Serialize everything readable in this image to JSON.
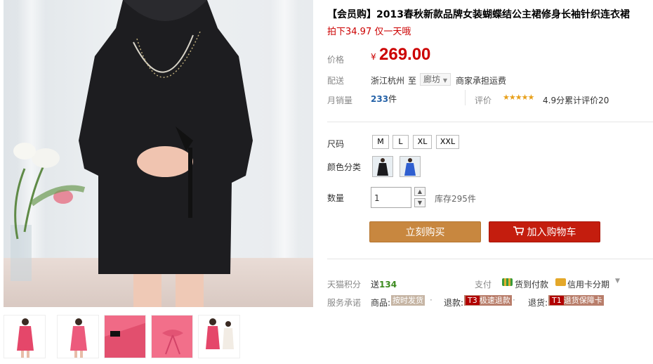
{
  "product": {
    "title": "【会员购】2013春秋新款品牌女装蝴蝶结公主裙修身长袖针织连衣裙",
    "promo": "拍下34.97 仅一天哦"
  },
  "price": {
    "label": "价格",
    "currency": "¥",
    "value": "269.00"
  },
  "shipping": {
    "label": "配送",
    "origin": "浙江杭州",
    "to": "至",
    "destination": "廊坊",
    "note": "商家承担运费"
  },
  "sales": {
    "label": "月销量",
    "count": "233",
    "unit": "件"
  },
  "rating": {
    "label": "评价",
    "stars": "★★★★★",
    "text": "4.9分累计评价20"
  },
  "size": {
    "label": "尺码",
    "options": [
      "M",
      "L",
      "XL",
      "XXL"
    ]
  },
  "color": {
    "label": "颜色分类",
    "options": [
      "black-dress",
      "blue-dress"
    ]
  },
  "quantity": {
    "label": "数量",
    "value": "1",
    "stock": "库存295件"
  },
  "buttons": {
    "buy": "立刻购买",
    "cart": "加入购物车"
  },
  "points": {
    "label": "天猫积分",
    "prefix": "送",
    "value": "134"
  },
  "payment": {
    "label": "支付",
    "cod": "货到付款",
    "installment": "信用卡分期"
  },
  "service": {
    "label": "服务承诺",
    "items": [
      {
        "prefix": "商品:",
        "badge": "",
        "text": "按时发货"
      },
      {
        "prefix": "退款:",
        "badge": "T3",
        "text": "极速退款"
      },
      {
        "prefix": "退货:",
        "badge": "T1",
        "text": "退货保障卡"
      }
    ]
  },
  "colors": {
    "price": "#cc0000",
    "buy": "#c8873f",
    "cart": "#c41d0e",
    "link": "#2562a8"
  }
}
